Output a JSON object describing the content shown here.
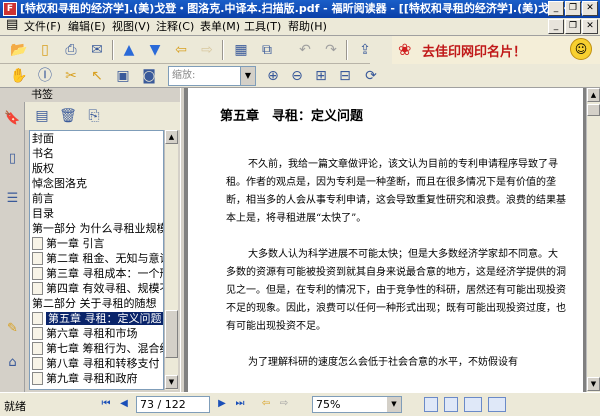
{
  "window": {
    "title": "[特权和寻租的经济学].(美)戈登・图洛克.中译本.扫描版.pdf - 福昕阅读器 - [[特权和寻租的经济学].(美)戈登・图",
    "controls": {
      "minimize": "_",
      "restore": "❐",
      "close": "✕",
      "menu_minimize": "_",
      "menu_restore": "❐",
      "menu_close": "✕"
    }
  },
  "menu": {
    "items": [
      "文件(F)",
      "编辑(E)",
      "视图(V)",
      "注释(C)",
      "表单(M)",
      "工具(T)",
      "帮助(H)"
    ]
  },
  "banner": {
    "text": "去佳印网印名片！"
  },
  "toolbar2": {
    "zoom_placeholder": "缩放:"
  },
  "panel": {
    "header": "书签"
  },
  "bookmarks": [
    {
      "label": "封面",
      "level": 0
    },
    {
      "label": "书名",
      "level": 0
    },
    {
      "label": "版权",
      "level": 0
    },
    {
      "label": "悼念图洛克",
      "level": 0
    },
    {
      "label": "前言",
      "level": 0
    },
    {
      "label": "目录",
      "level": 0
    },
    {
      "label": "第一部分 为什么寻租业规模如此之小",
      "level": 0
    },
    {
      "label": "第一章 引言",
      "level": 1
    },
    {
      "label": "第二章 租金、无知与意识形态",
      "level": 1
    },
    {
      "label": "第三章 寻租成本：一个形式分析",
      "level": 1
    },
    {
      "label": "第四章 有效寻租、规模不经济",
      "level": 1
    },
    {
      "label": "第二部分 关于寻租的随想",
      "level": 0
    },
    {
      "label": "第五章 寻租：定义问题",
      "level": 1,
      "selected": true
    },
    {
      "label": "第六章 寻租和市场",
      "level": 1
    },
    {
      "label": "第七章 筹租行为、混合经济",
      "level": 1
    },
    {
      "label": "第八章 寻租和转移支付",
      "level": 1
    },
    {
      "label": "第九章 寻租和政府",
      "level": 1
    }
  ],
  "document": {
    "chapter_title": "第五章　寻租：定义问题",
    "paragraphs": [
      "不久前，我给一篇文章做评论，该文认为目前的专利申请程序导致了寻租。作者的观点是，因为专利是一种垄断，而且在很多情况下是有价值的垄断，相当多的人会从事专利申请，这会导致重复性研究和浪费。浪费的结果基本上是，将寻租进展“太快了”。",
      "大多数人认为科学进展不可能太快；但是大多数经济学家却不同意。大多数的资源有可能被投资到就其自身来说最合意的地方，这是经济学提供的洞见之一。但是，在专利的情况下，由于竞争性的科研，居然还有可能出现投资不足的现象。因此，浪费可以任何一种形式出现；既有可能出现投资过度，也有可能出现投资不足。",
      "为了理解科研的速度怎么会低于社会合意的水平，不妨假设有"
    ]
  },
  "status": {
    "text": "就绪",
    "page_indicator": "73 / 122",
    "zoom": "75%"
  }
}
